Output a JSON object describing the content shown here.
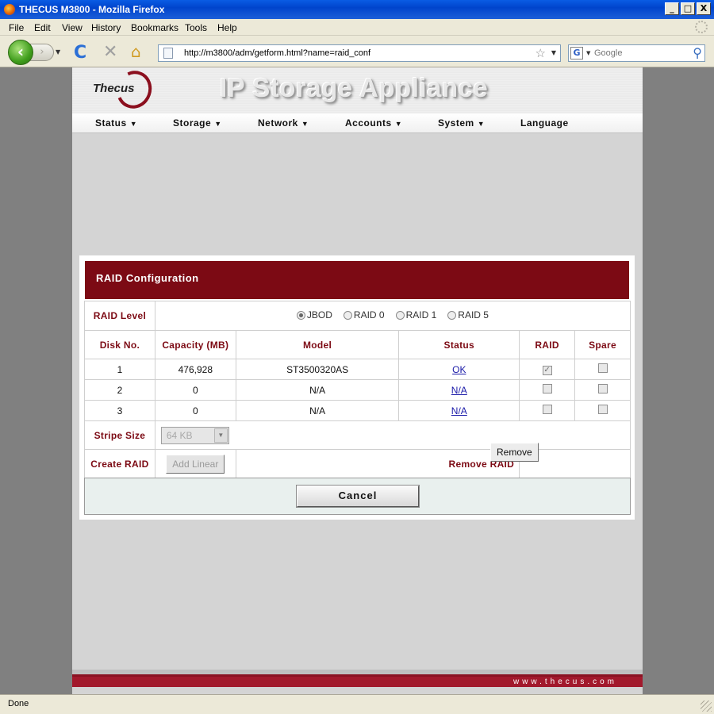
{
  "window": {
    "title": "THECUS M3800 - Mozilla Firefox",
    "minimize": "_",
    "maximize": "□",
    "close": "X"
  },
  "menu": [
    "File",
    "Edit",
    "View",
    "History",
    "Bookmarks",
    "Tools",
    "Help"
  ],
  "toolbar": {
    "back_icon": "‹",
    "forward_icon": "›",
    "reload_icon": "C",
    "stop_icon": "✕",
    "home_icon": "⌂",
    "url": "http://m3800/adm/getform.html?name=raid_conf",
    "search_engine": "G",
    "search_placeholder": "Google"
  },
  "banner": {
    "logo_text": "Thecus",
    "title": "IP Storage Appliance"
  },
  "nav": [
    {
      "label": "Status",
      "caret": "▼"
    },
    {
      "label": "Storage",
      "caret": "▼"
    },
    {
      "label": "Network",
      "caret": "▼"
    },
    {
      "label": "Accounts",
      "caret": "▼"
    },
    {
      "label": "System",
      "caret": "▼"
    },
    {
      "label": "Language",
      "caret": ""
    }
  ],
  "raid": {
    "title": "RAID Configuration",
    "level_label": "RAID Level",
    "levels": [
      {
        "label": "JBOD",
        "selected": true
      },
      {
        "label": "RAID 0",
        "selected": false
      },
      {
        "label": "RAID 1",
        "selected": false
      },
      {
        "label": "RAID 5",
        "selected": false
      }
    ],
    "columns": [
      "Disk No.",
      "Capacity (MB)",
      "Model",
      "Status",
      "RAID",
      "Spare"
    ],
    "disks": [
      {
        "no": "1",
        "capacity": "476,928",
        "model": "ST3500320AS",
        "status": "OK",
        "raid": true,
        "spare": false
      },
      {
        "no": "2",
        "capacity": "0",
        "model": "N/A",
        "status": "N/A",
        "raid": false,
        "spare": false
      },
      {
        "no": "3",
        "capacity": "0",
        "model": "N/A",
        "status": "N/A",
        "raid": false,
        "spare": false
      }
    ],
    "stripe_label": "Stripe Size",
    "stripe_value": "64 KB",
    "create_label": "Create RAID",
    "create_button": "Add Linear",
    "remove_label": "Remove RAID",
    "remove_button": "Remove",
    "cancel_button": "Cancel"
  },
  "footer": {
    "text": "www.thecus.com"
  },
  "status": {
    "text": "Done"
  }
}
